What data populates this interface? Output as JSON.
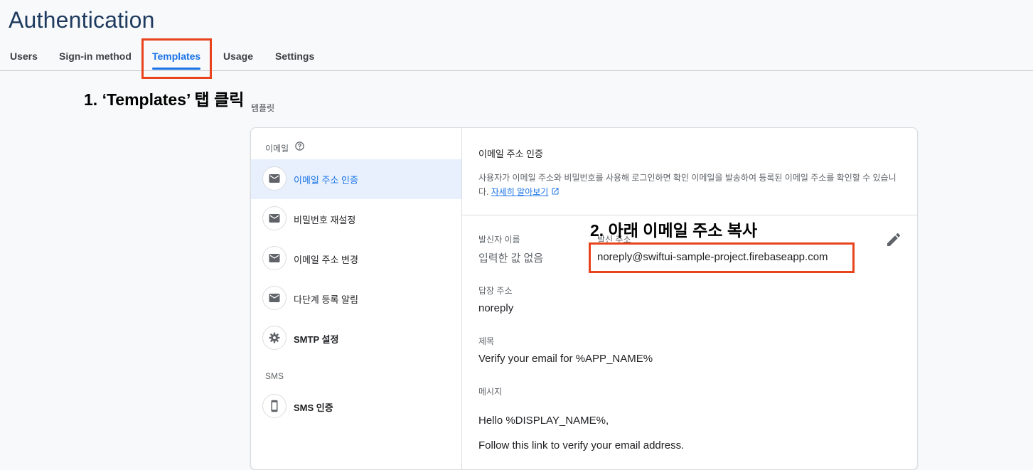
{
  "page_title": "Authentication",
  "tabs": [
    {
      "label": "Users"
    },
    {
      "label": "Sign-in method"
    },
    {
      "label": "Templates"
    },
    {
      "label": "Usage"
    },
    {
      "label": "Settings"
    }
  ],
  "active_tab": "Templates",
  "annotations": {
    "step1": "1. ‘Templates’ 탭 클릭",
    "step1_sub": "템플릿",
    "step2": "2. 아래 이메일 주소 복사"
  },
  "sidebar": {
    "email_section": "이메일",
    "sms_section": "SMS",
    "items": [
      {
        "label": "이메일 주소 인증",
        "icon": "mail-icon"
      },
      {
        "label": "비밀번호 재설정",
        "icon": "mail-icon"
      },
      {
        "label": "이메일 주소 변경",
        "icon": "mail-icon"
      },
      {
        "label": "다단계 등록 알림",
        "icon": "mail-icon"
      },
      {
        "label": "SMTP 설정",
        "icon": "gear-icon"
      },
      {
        "label": "SMS 인증",
        "icon": "phone-icon"
      }
    ]
  },
  "template": {
    "title": "이메일 주소 인증",
    "description": "사용자가 이메일 주소와 비밀번호를 사용해 로그인하면 확인 이메일을 발송하여 등록된 이메일 주소를 확인할 수 있습니다.",
    "learn_more": "자세히 알아보기",
    "sender_name_label": "발신자 이름",
    "sender_name_value": "입력한 값 없음",
    "from_label": "발신 주소",
    "from_value": "noreply@swiftui-sample-project.firebaseapp.com",
    "reply_to_label": "답장 주소",
    "reply_to_value": "noreply",
    "subject_label": "제목",
    "subject_value": "Verify your email for %APP_NAME%",
    "message_label": "메시지",
    "message_line1": "Hello %DISPLAY_NAME%,",
    "message_line2": "Follow this link to verify your email address."
  },
  "colors": {
    "accent": "#1a73e8",
    "highlight": "#e8431c",
    "title": "#1e3a5f"
  }
}
